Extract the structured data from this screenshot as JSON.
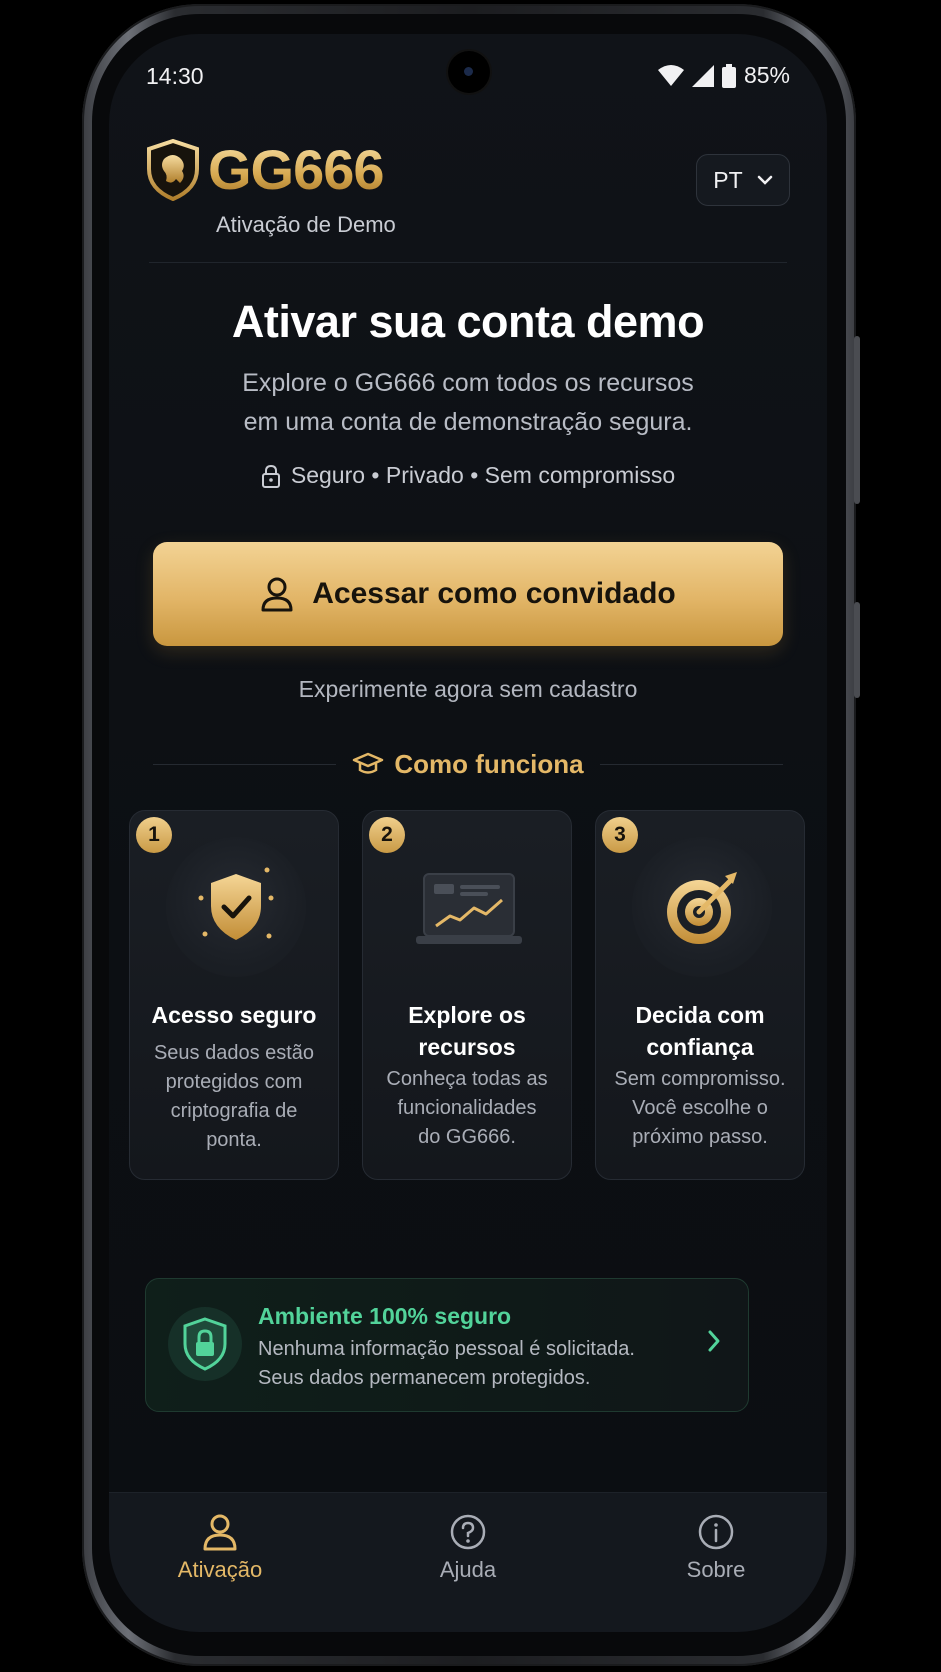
{
  "status_bar": {
    "time": "14:30",
    "battery": "85%"
  },
  "header": {
    "brand": "GG666",
    "subtitle": "Ativação de Demo",
    "language": "PT"
  },
  "hero": {
    "title": "Ativar sua conta demo",
    "description_line1": "Explore o GG666 com todos os recursos",
    "description_line2": "em uma conta de demonstração segura.",
    "trust_line": "Seguro • Privado • Sem compromisso"
  },
  "cta": {
    "label": "Acessar como convidado",
    "sub_label": "Experimente agora sem cadastro"
  },
  "how_it_works": {
    "heading": "Como funciona",
    "steps": [
      {
        "number": "1",
        "title": "Acesso seguro",
        "text_lines": [
          "Seus dados estão",
          "protegidos com",
          "criptografia de",
          "ponta."
        ],
        "icon": "shield-check-icon"
      },
      {
        "number": "2",
        "title_lines": [
          "Explore os",
          "recursos"
        ],
        "text_lines": [
          "Conheça todas as",
          "funcionalidades",
          "do GG666."
        ],
        "icon": "laptop-chart-icon"
      },
      {
        "number": "3",
        "title_lines": [
          "Decida com",
          "confiança"
        ],
        "text_lines": [
          "Sem compromisso.",
          "Você escolhe o",
          "próximo passo."
        ],
        "icon": "target-arrow-icon"
      }
    ]
  },
  "secure_notice": {
    "title": "Ambiente 100% seguro",
    "line1": "Nenhuma informação pessoal é solicitada.",
    "line2": "Seus dados permanecem protegidos."
  },
  "bottom_nav": {
    "items": [
      {
        "label": "Ativação",
        "icon": "user-icon",
        "active": true
      },
      {
        "label": "Ajuda",
        "icon": "help-circle-icon",
        "active": false
      },
      {
        "label": "Sobre",
        "icon": "info-circle-icon",
        "active": false
      }
    ]
  },
  "colors": {
    "accent_gold": "#e4b867",
    "secure_green": "#52d39a",
    "background": "#0c0f13"
  }
}
